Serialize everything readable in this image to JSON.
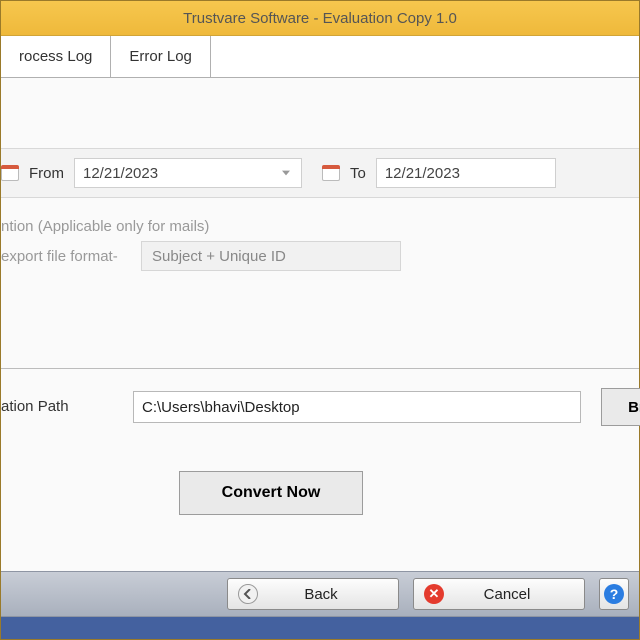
{
  "title": "Trustvare Software - Evaluation Copy 1.0",
  "tabs": {
    "process": "rocess Log",
    "error": "Error Log"
  },
  "date": {
    "from_label": "From",
    "from_value": "12/21/2023",
    "to_label": "To",
    "to_value": "12/21/2023"
  },
  "naming_section_label": "ntion (Applicable only for mails)",
  "format_label": "export file format-",
  "format_value": "Subject + Unique ID",
  "dest_label": "ation Path",
  "dest_value": "C:\\Users\\bhavi\\Desktop",
  "browse_label": "Browse",
  "convert_label": "Convert Now",
  "footer": {
    "back": "Back",
    "cancel": "Cancel"
  }
}
